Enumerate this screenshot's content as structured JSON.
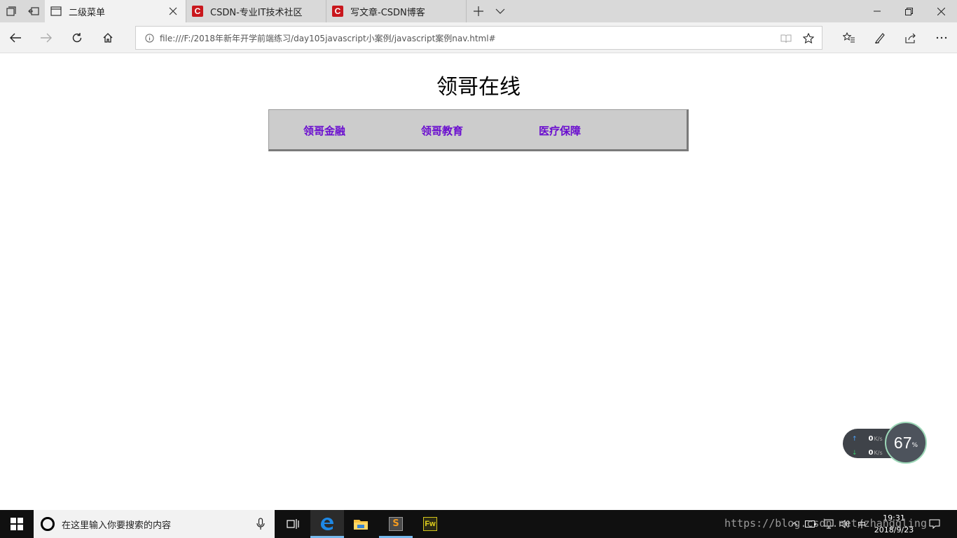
{
  "browser": {
    "tabs": [
      {
        "label": "二级菜单",
        "active": true
      },
      {
        "label": "CSDN-专业IT技术社区",
        "active": false
      },
      {
        "label": "写文章-CSDN博客",
        "active": false
      }
    ],
    "address_url": "file:///F:/2018年新年开学前端练习/day105javascript小案例/javascript案例nav.html#",
    "favicon_letter": "C",
    "accent": "#c9171d"
  },
  "page": {
    "heading": "领哥在线",
    "menu": [
      {
        "label": "领哥金融"
      },
      {
        "label": "领哥教育"
      },
      {
        "label": "医疗保障"
      }
    ],
    "menu_color": "#6a0dcf",
    "menu_bg": "#cccccc"
  },
  "speed_widget": {
    "up_value": "0",
    "up_unit": "K/s",
    "down_value": "0",
    "down_unit": "K/s",
    "percent": "67",
    "percent_sign": "%"
  },
  "taskbar": {
    "search_placeholder": "在这里输入你要搜索的内容",
    "ime_label": "中",
    "time": "19:31",
    "date": "2018/9/23",
    "fw_label": "Fw",
    "s_label": "S"
  },
  "watermark": "https://blog.csdn.net/zhangqling"
}
